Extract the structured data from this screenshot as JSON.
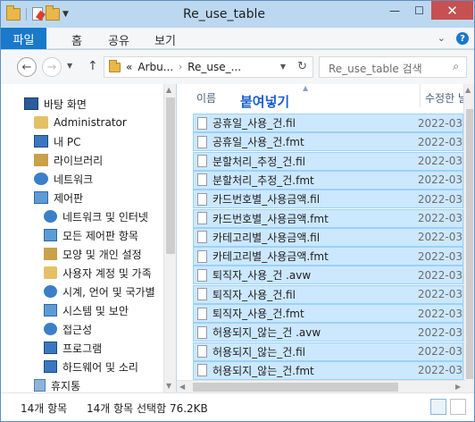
{
  "window": {
    "title": "Re_use_table"
  },
  "ribbon": {
    "file_tab": "파일",
    "tabs": [
      "홈",
      "공유",
      "보기"
    ]
  },
  "nav": {
    "breadcrumb": [
      "«",
      "Arbu...",
      "Re_use_..."
    ],
    "search_placeholder": "Re_use_table 검색"
  },
  "sidebar": {
    "items": [
      {
        "label": "바탕 화면",
        "icon": "desktop-icon"
      },
      {
        "label": "Administrator",
        "icon": "user-folder-icon"
      },
      {
        "label": "내 PC",
        "icon": "pc-icon"
      },
      {
        "label": "라이브러리",
        "icon": "library-icon"
      },
      {
        "label": "네트워크",
        "icon": "network-icon"
      },
      {
        "label": "제어판",
        "icon": "control-panel-icon"
      },
      {
        "label": "네트워크 및 인터넷",
        "icon": "network-internet-icon"
      },
      {
        "label": "모든 제어판 항목",
        "icon": "all-control-panel-icon"
      },
      {
        "label": "모양 및 개인 설정",
        "icon": "appearance-icon"
      },
      {
        "label": "사용자 계정 및 가족",
        "icon": "user-accounts-icon"
      },
      {
        "label": "시계, 언어 및 국가별",
        "icon": "clock-language-icon"
      },
      {
        "label": "시스템 및 보안",
        "icon": "system-security-icon"
      },
      {
        "label": "접근성",
        "icon": "accessibility-icon"
      },
      {
        "label": "프로그램",
        "icon": "programs-icon"
      },
      {
        "label": "하드웨어 및 소리",
        "icon": "hardware-sound-icon"
      },
      {
        "label": "휴지통",
        "icon": "recycle-bin-icon"
      }
    ]
  },
  "files": {
    "col_name": "이름",
    "col_modified": "수정한 날",
    "overlay_text": "붙여넣기",
    "rows": [
      {
        "name": "공휴일_사용_건.fil",
        "date": "2022-03"
      },
      {
        "name": "공휴일_사용_건.fmt",
        "date": "2022-03"
      },
      {
        "name": "분할처리_추정_건.fil",
        "date": "2022-03"
      },
      {
        "name": "분할처리_추정_건.fmt",
        "date": "2022-03"
      },
      {
        "name": "카드번호별_사용금액.fil",
        "date": "2022-03"
      },
      {
        "name": "카드번호별_사용금액.fmt",
        "date": "2022-03"
      },
      {
        "name": "카테고리별_사용금액.fil",
        "date": "2022-03"
      },
      {
        "name": "카테고리별_사용금액.fmt",
        "date": "2022-03"
      },
      {
        "name": "퇴직자_사용_건 .avw",
        "date": "2022-03"
      },
      {
        "name": "퇴직자_사용_건.fil",
        "date": "2022-03"
      },
      {
        "name": "퇴직자_사용_건.fmt",
        "date": "2022-03"
      },
      {
        "name": "허용되지_않는_건 .avw",
        "date": "2022-03"
      },
      {
        "name": "허용되지_않는_건.fil",
        "date": "2022-03"
      },
      {
        "name": "허용되지_않는_건.fmt",
        "date": "2022-03"
      }
    ]
  },
  "status": {
    "count": "14개 항목",
    "selected": "14개 항목 선택함 76.2KB"
  }
}
